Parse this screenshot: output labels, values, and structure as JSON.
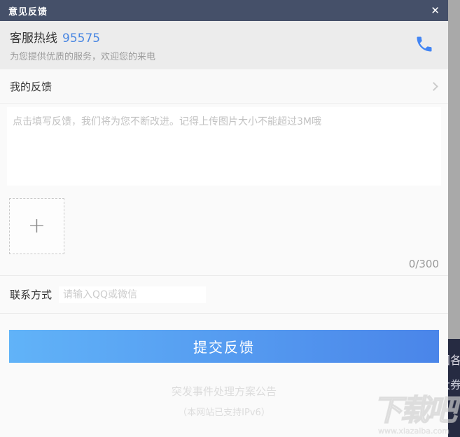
{
  "dialog": {
    "title": "意见反馈",
    "close_glyph": "✕"
  },
  "hotline": {
    "label": "客服热线",
    "number": "95575",
    "subtitle": "为您提供优质的服务，欢迎您的来电"
  },
  "my_feedback": {
    "label": "我的反馈"
  },
  "feedback_input": {
    "placeholder": "点击填写反馈，我们将为您不断改进。记得上传图片大小不能超过3M哦"
  },
  "upload": {
    "plus_glyph": "+"
  },
  "counter": "0/300",
  "contact": {
    "label": "联系方式",
    "placeholder": "请输入QQ或微信"
  },
  "submit": {
    "label": "提交反馈"
  },
  "footer": {
    "link1": "突发事件处理方案公告",
    "link2": "（本网站已支持IPv6）"
  },
  "background_page": {
    "partial_line1": "国各",
    "partial_line2": "大券"
  },
  "watermark": {
    "logo": "下载吧",
    "url": "www.xiazaiba.com"
  },
  "colors": {
    "titlebar": "#455069",
    "accent_blue": "#4a87e2",
    "button_gradient_start": "#61b3f8",
    "button_gradient_end": "#4a85e9",
    "hotline_bg": "#ececec",
    "background_dark": "#262b42"
  }
}
